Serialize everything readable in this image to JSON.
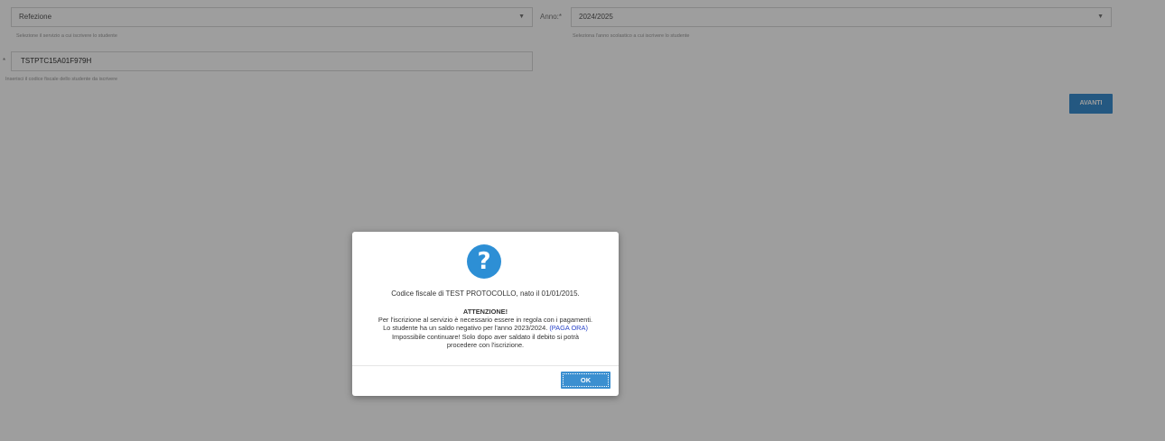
{
  "form": {
    "service": {
      "value": "Refezione",
      "hint": "Selezione il servizio a cui iscrivere lo studente"
    },
    "year": {
      "label": "Anno:*",
      "value": "2024/2025",
      "hint": "Seleziona l'anno scolastico a cui iscrivere lo studente"
    },
    "fiscal_code": {
      "required_mark": "*",
      "value": "TSTPTC15A01F979H",
      "hint": "Inserisci il codice fiscale dello studente da iscrivere"
    },
    "next_label": "AVANTI"
  },
  "dialog": {
    "icon": "question-icon",
    "icon_glyph": "?",
    "line1": "Codice fiscale di TEST PROTOCOLLO, nato il 01/01/2015.",
    "attention": "ATTENZIONE!",
    "msg1": "Per l'iscrizione al servizio è necessario essere in regola con i pagamenti.",
    "msg2_prefix": "Lo studente ha un saldo negativo per l'anno 2023/2024.",
    "pay_link": "(PAGA ORA)",
    "msg3": "Impossibile continuare! Solo dopo aver saldato il debito si potrà",
    "msg4": "procedere con l'iscrizione.",
    "ok_label": "OK"
  },
  "colors": {
    "accent": "#3b8fd0",
    "icon_bg": "#2d8fd5",
    "link": "#2a44c9",
    "overlay": "rgba(0,0,0,0.38)"
  }
}
